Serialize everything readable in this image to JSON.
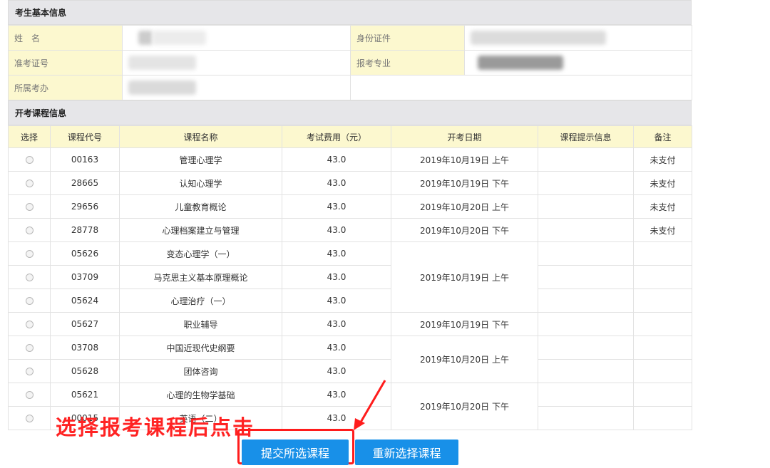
{
  "basic_info": {
    "section_title": "考生基本信息",
    "name_label": "姓　名",
    "id_label": "身份证件",
    "ticket_label": "准考证号",
    "major_label": "报考专业",
    "office_label": "所属考办"
  },
  "courses_section": {
    "section_title": "开考课程信息",
    "headers": [
      "选择",
      "课程代号",
      "课程名称",
      "考试费用（元）",
      "开考日期",
      "课程提示信息",
      "备注"
    ],
    "rows": [
      {
        "code": "00163",
        "name": "管理心理学",
        "fee": "43.0",
        "date": "2019年10月19日 上午",
        "note": "未支付"
      },
      {
        "code": "28665",
        "name": "认知心理学",
        "fee": "43.0",
        "date": "2019年10月19日 下午",
        "note": "未支付"
      },
      {
        "code": "29656",
        "name": "儿童教育概论",
        "fee": "43.0",
        "date": "2019年10月20日 上午",
        "note": "未支付"
      },
      {
        "code": "28778",
        "name": "心理档案建立与管理",
        "fee": "43.0",
        "date": "2019年10月20日 下午",
        "note": "未支付"
      },
      {
        "code": "05626",
        "name": "变态心理学（一）",
        "fee": "43.0",
        "date": "2019年10月19日 上午",
        "note": ""
      },
      {
        "code": "03709",
        "name": "马克思主义基本原理概论",
        "fee": "43.0",
        "date": "",
        "note": ""
      },
      {
        "code": "05624",
        "name": "心理治疗（一）",
        "fee": "43.0",
        "date": "",
        "note": ""
      },
      {
        "code": "05627",
        "name": "职业辅导",
        "fee": "43.0",
        "date": "2019年10月19日 下午",
        "note": ""
      },
      {
        "code": "03708",
        "name": "中国近现代史纲要",
        "fee": "43.0",
        "date": "2019年10月20日 上午",
        "note": ""
      },
      {
        "code": "05628",
        "name": "团体咨询",
        "fee": "43.0",
        "date": "",
        "note": ""
      },
      {
        "code": "05621",
        "name": "心理的生物学基础",
        "fee": "43.0",
        "date": "2019年10月20日 下午",
        "note": ""
      },
      {
        "code": "00015",
        "name": "英语（二）",
        "fee": "43.0",
        "date": "",
        "note": ""
      }
    ]
  },
  "annotation": "选择报考课程后点击",
  "buttons": {
    "submit": "提交所选课程",
    "reset": "重新选择课程"
  },
  "colors": {
    "accent": "#1890e8",
    "warning": "#ff0000",
    "label_bg": "#fcf8cf",
    "section_bg": "#e6e6e9"
  }
}
